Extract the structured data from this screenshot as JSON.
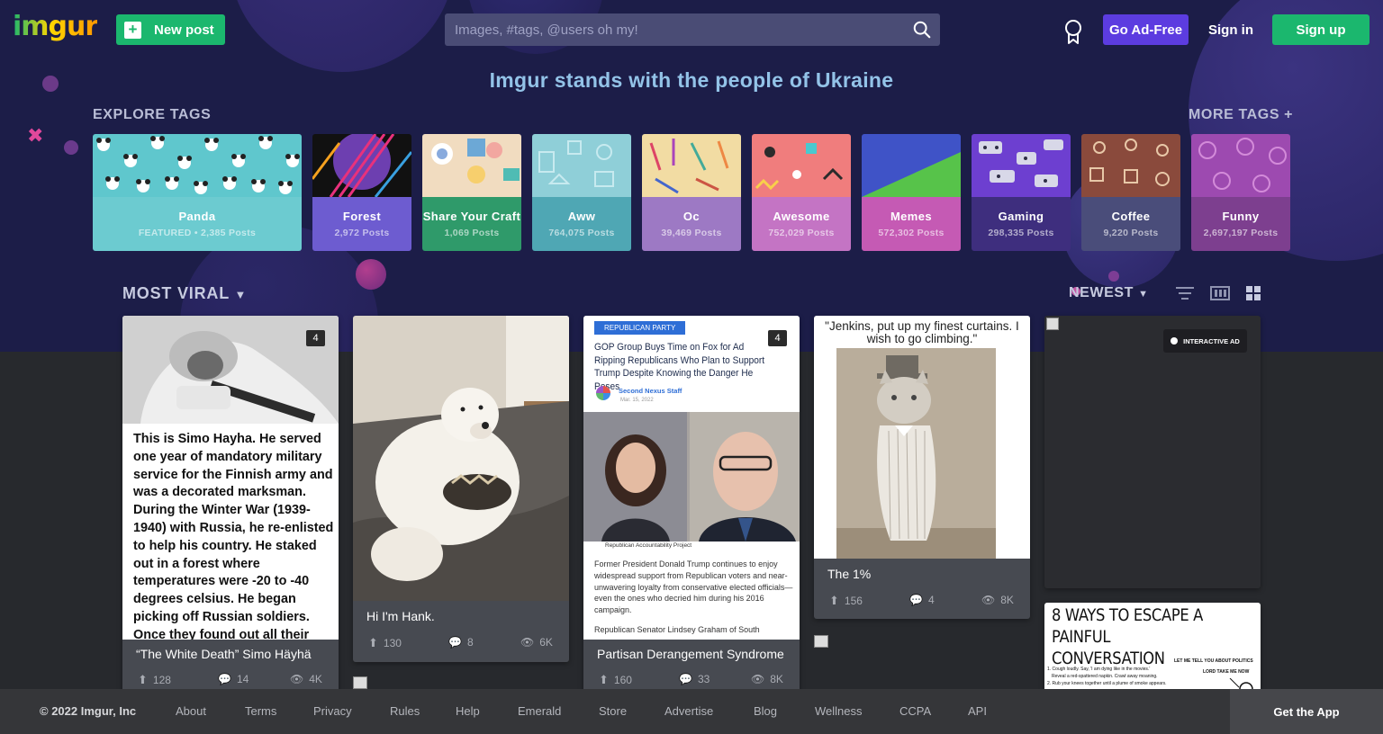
{
  "header": {
    "logo": "imgur",
    "new_post": "New post",
    "search_placeholder": "Images, #tags, @users oh my!",
    "go_ad_free": "Go Ad-Free",
    "sign_in": "Sign in",
    "sign_up": "Sign up"
  },
  "banner": "Imgur stands with the people of Ukraine",
  "explore": {
    "title": "EXPLORE TAGS",
    "more": "MORE TAGS +",
    "tags": [
      {
        "name": "Panda",
        "count": "FEATURED • 2,385 Posts",
        "color": "#6ccbd0"
      },
      {
        "name": "Forest",
        "count": "2,972 Posts",
        "color": "#6d5cd0"
      },
      {
        "name": "Share Your Craft",
        "count": "1,069 Posts",
        "color": "#2f9a6a"
      },
      {
        "name": "Aww",
        "count": "764,075 Posts",
        "color": "#4fa7b4"
      },
      {
        "name": "Oc",
        "count": "39,469 Posts",
        "color": "#9d79c4"
      },
      {
        "name": "Awesome",
        "count": "752,029 Posts",
        "color": "#c474c4"
      },
      {
        "name": "Memes",
        "count": "572,302 Posts",
        "color": "#c55ab4"
      },
      {
        "name": "Gaming",
        "count": "298,335 Posts",
        "color": "#3e2e7e"
      },
      {
        "name": "Coffee",
        "count": "9,220 Posts",
        "color": "#4a4d7a"
      },
      {
        "name": "Funny",
        "count": "2,697,197 Posts",
        "color": "#7d3f8f"
      }
    ]
  },
  "feed": {
    "section": "MOST VIRAL",
    "sort": "NEWEST",
    "posts": [
      {
        "title": "“The White Death” Simo Häyhä",
        "ups": "128",
        "comments": "14",
        "views": "4K",
        "badge": "4",
        "text": "This is Simo Hayha. He served one year of mandatory military service for the Finnish army and was a decorated marksman. During the Winter War (1939-1940) with Russia, he re-enlisted to help his country. He staked out in a forest where temperatures were -20 to -40 degrees celsius. He began picking off Russian soldiers. Once they found out all their"
      },
      {
        "title": "Hi I'm Hank.",
        "ups": "130",
        "comments": "8",
        "views": "6K"
      },
      {
        "title": "Partisan Derangement Syndrome",
        "ups": "160",
        "comments": "33",
        "views": "8K",
        "badge": "4",
        "tag": "REPUBLICAN PARTY",
        "headline": "GOP Group Buys Time on Fox for Ad Ripping Republicans Who Plan to Support Trump Despite Knowing the Danger He Poses",
        "author": "Second Nexus Staff",
        "date": "Mar. 15, 2022",
        "caption": "Republican Accountability Project",
        "body": "Former President Donald Trump continues to enjoy widespread support from Republican voters and near-unwavering loyalty from conservative elected officials—even the ones who decried him during his 2016 campaign.",
        "body2": "Republican Senator Lindsey Graham of South"
      },
      {
        "title": "The 1%",
        "ups": "156",
        "comments": "4",
        "views": "8K",
        "quote": "\"Jenkins, put up my finest curtains. I wish to go climbing.\""
      },
      {
        "ad_label": "INTERACTIVE AD"
      },
      {
        "comic_title": "8 WAYS TO ESCAPE A PAINFUL CONVERSATION",
        "comic_speech": "LET ME TELL YOU ABOUT POLITICS",
        "comic_speech2": "LORD TAKE ME NOW",
        "comic_lines": [
          "1. Cough loudly. Say, 'I am dying like in the movies.'",
          "Reveal a red-spattered napkin. Crawl away moaning.",
          "2. Rub your knees together until a plume of smoke appears."
        ]
      }
    ]
  },
  "footer": {
    "copyright": "© 2022 Imgur, Inc",
    "links": [
      "About",
      "Terms",
      "Privacy",
      "Rules",
      "Help",
      "Emerald",
      "Store",
      "Advertise",
      "Blog",
      "Wellness",
      "CCPA",
      "API"
    ],
    "get_app": "Get the App"
  }
}
